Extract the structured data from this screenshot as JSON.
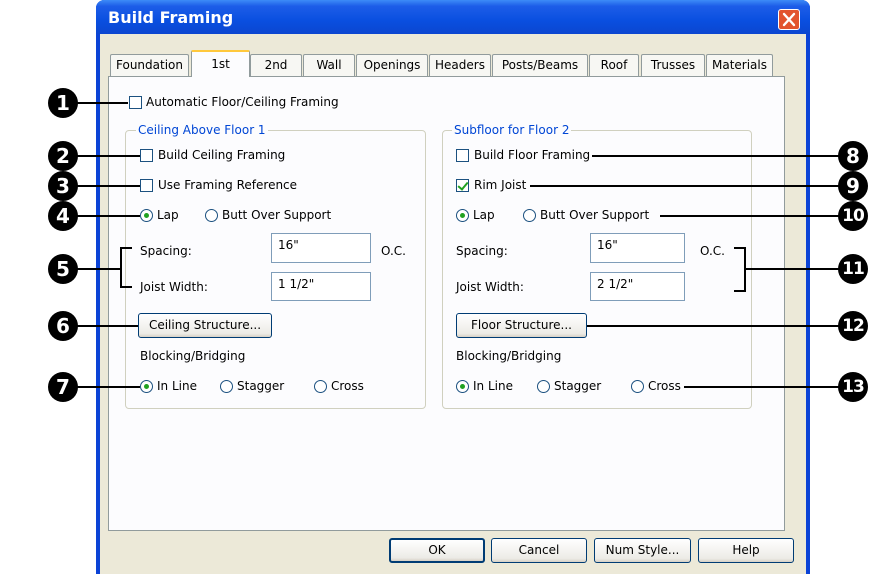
{
  "window": {
    "title": "Build Framing"
  },
  "tabs": [
    "Foundation",
    "1st",
    "2nd",
    "Wall",
    "Openings",
    "Headers",
    "Posts/Beams",
    "Roof",
    "Trusses",
    "Materials"
  ],
  "auto_framing_label": "Automatic Floor/Ceiling Framing",
  "left_group": {
    "title": "Ceiling Above Floor 1",
    "build_label": "Build Ceiling Framing",
    "reference_label": "Use Framing Reference",
    "lap_label": "Lap",
    "butt_label": "Butt Over Support",
    "spacing_label": "Spacing:",
    "spacing_value": "16\"",
    "oc_label": "O.C.",
    "joist_label": "Joist Width:",
    "joist_value": "1 1/2\"",
    "structure_button": "Ceiling Structure...",
    "blocking_label": "Blocking/Bridging",
    "inline_label": "In Line",
    "stagger_label": "Stagger",
    "cross_label": "Cross"
  },
  "right_group": {
    "title": "Subfloor for Floor 2",
    "build_label": "Build Floor Framing",
    "rim_label": "Rim Joist",
    "lap_label": "Lap",
    "butt_label": "Butt Over Support",
    "spacing_label": "Spacing:",
    "spacing_value": "16\"",
    "oc_label": "O.C.",
    "joist_label": "Joist Width:",
    "joist_value": "2 1/2\"",
    "structure_button": "Floor Structure...",
    "blocking_label": "Blocking/Bridging",
    "inline_label": "In Line",
    "stagger_label": "Stagger",
    "cross_label": "Cross"
  },
  "buttons": {
    "ok": "OK",
    "cancel": "Cancel",
    "num_style": "Num Style...",
    "help": "Help"
  },
  "callouts": [
    "1",
    "2",
    "3",
    "4",
    "5",
    "6",
    "7",
    "8",
    "9",
    "10",
    "11",
    "12",
    "13"
  ],
  "colors": {
    "title_bar": "#0a4fe0",
    "close_button": "#e2542e",
    "group_title": "#0046d5",
    "active_tab_accent": "#ffc83c"
  }
}
